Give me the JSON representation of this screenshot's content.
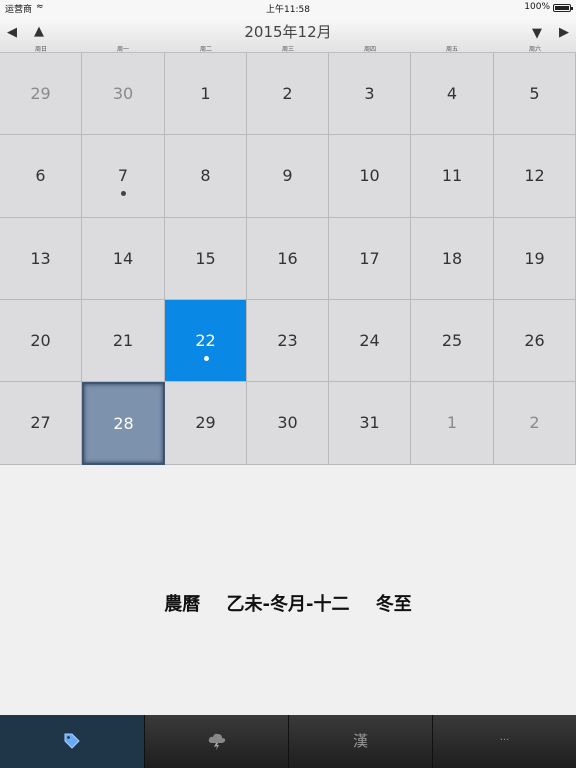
{
  "status": {
    "carrier": "运营商",
    "time": "上午11:58",
    "battery": "100%"
  },
  "header": {
    "title": "2015年12月"
  },
  "weekdays": [
    "周日",
    "周一",
    "周二",
    "周三",
    "周四",
    "周五",
    "周六"
  ],
  "days": [
    [
      "29",
      "30",
      "1",
      "2",
      "3",
      "4",
      "5"
    ],
    [
      "6",
      "7",
      "8",
      "9",
      "10",
      "11",
      "12"
    ],
    [
      "13",
      "14",
      "15",
      "16",
      "17",
      "18",
      "19"
    ],
    [
      "20",
      "21",
      "22",
      "23",
      "24",
      "25",
      "26"
    ],
    [
      "27",
      "28",
      "29",
      "30",
      "31",
      "1",
      "2"
    ]
  ],
  "lunar": {
    "label": "農曆",
    "date": "乙未-冬月-十二",
    "solar_term": "冬至"
  },
  "tabs": {
    "t3": "漢",
    "t4": "···"
  },
  "colors": {
    "selected": "#0a88e6",
    "today": "#7d92ad",
    "tab_active": "#1f3548"
  }
}
